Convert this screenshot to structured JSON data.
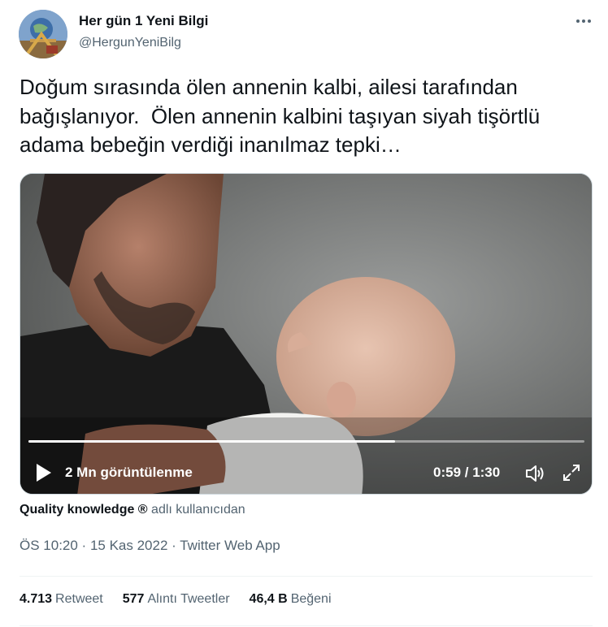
{
  "author": {
    "name": "Her gün 1 Yeni Bilgi",
    "handle": "@HergunYeniBilg"
  },
  "tweet": {
    "text": "Doğum sırasında ölen annenin kalbi, ailesi tarafından bağışlanıyor.  Ölen annenin kalbini taşıyan siyah tişörtlü adama bebeğin verdiği inanılmaz tepki…"
  },
  "video": {
    "views": "2 Mn görüntülenme",
    "time": "0:59 / 1:30",
    "progress": 0.66
  },
  "source": {
    "account": "Quality knowledge ®",
    "suffix": " adlı kullanıcıdan"
  },
  "meta": {
    "time": "ÖS 10:20",
    "separator": " · ",
    "date": "15 Kas 2022",
    "app": "Twitter Web App"
  },
  "stats": {
    "retweets_count": "4.713",
    "retweets_label": "Retweet",
    "quotes_count": "577",
    "quotes_label": "Alıntı Tweetler",
    "likes_count": "46,4 B",
    "likes_label": "Beğeni"
  },
  "icons": {
    "more": "more-dots-icon",
    "play": "play-icon",
    "volume": "volume-icon",
    "fullscreen": "fullscreen-icon"
  }
}
